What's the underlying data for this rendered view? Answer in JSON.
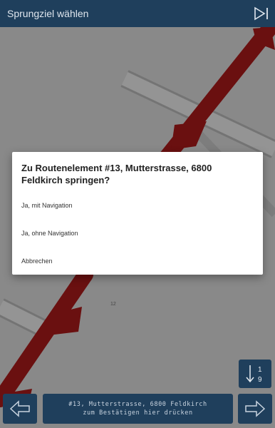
{
  "header": {
    "title": "Sprungziel wählen",
    "skip_icon": "skip-to-end-icon"
  },
  "map": {
    "marker_label": "12",
    "route_color": "#b71c1c"
  },
  "dialog": {
    "title": "Zu Routenelement #13, Mutterstrasse, 6800 Feldkirch springen?",
    "options": [
      "Ja, mit Navigation",
      "Ja, ohne Navigation",
      "Abbrechen"
    ]
  },
  "footer": {
    "sort_icon": "sort-1-9-icon",
    "sort_label_top": "1",
    "sort_label_bottom": "9",
    "prev_icon": "arrow-left-icon",
    "next_icon": "arrow-right-icon",
    "confirm_line1": "#13, Mutterstrasse, 6800 Feldkirch",
    "confirm_line2": "zum Bestätigen hier drücken"
  },
  "colors": {
    "bar": "#1f3f5c",
    "route": "#b71c1c",
    "map_bg": "#ececec"
  }
}
